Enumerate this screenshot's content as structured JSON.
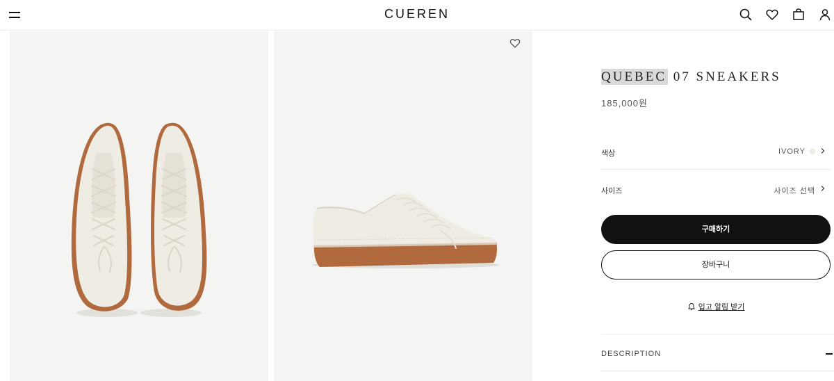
{
  "header": {
    "brand": "CUEREN"
  },
  "product": {
    "title_highlight": "QUEBEC",
    "title_rest": " 07 SNEAKERS",
    "price": "185,000원",
    "color_label": "색상",
    "color_value": "IVORY",
    "size_label": "사이즈",
    "size_value": "사이즈 선택",
    "buy_label": "구매하기",
    "cart_label": "장바구니",
    "notify_label": "입고 알림 받기",
    "description_label": "DESCRIPTION"
  },
  "colors": {
    "background_panel": "#f4f4f2",
    "shoe_upper": "#efece4",
    "sole": "#b06a3e",
    "swatch_ivory": "#f3efe4",
    "primary_button": "#111111"
  },
  "icons": {
    "menu": "menu-icon",
    "search": "search-icon",
    "wishlist": "heart-icon",
    "bag": "bag-icon",
    "account": "user-icon",
    "notify": "bell-icon"
  }
}
